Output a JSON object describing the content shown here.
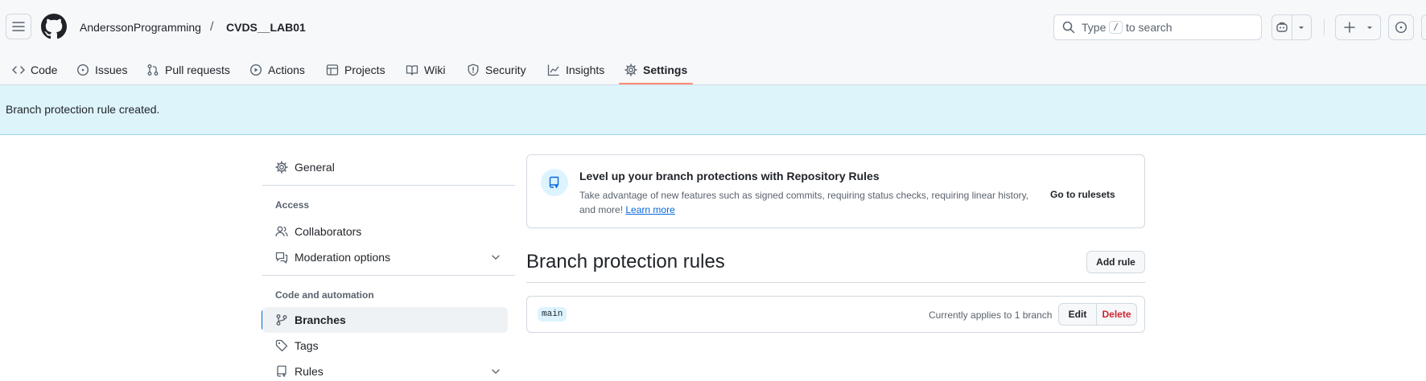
{
  "header": {
    "owner": "AnderssonProgramming",
    "separator": "/",
    "repo": "CVDS__LAB01",
    "search_prefix": "Type",
    "search_key": "/",
    "search_suffix": "to search"
  },
  "tabs": [
    {
      "label": "Code",
      "icon": "code-icon"
    },
    {
      "label": "Issues",
      "icon": "issue-opened-icon"
    },
    {
      "label": "Pull requests",
      "icon": "git-pull-request-icon"
    },
    {
      "label": "Actions",
      "icon": "play-icon"
    },
    {
      "label": "Projects",
      "icon": "table-icon"
    },
    {
      "label": "Wiki",
      "icon": "book-icon"
    },
    {
      "label": "Security",
      "icon": "shield-icon"
    },
    {
      "label": "Insights",
      "icon": "graph-icon"
    },
    {
      "label": "Settings",
      "icon": "gear-icon",
      "active": true
    }
  ],
  "flash": {
    "message": "Branch protection rule created."
  },
  "sidebar": {
    "general": "General",
    "access_heading": "Access",
    "collaborators": "Collaborators",
    "moderation": "Moderation options",
    "code_heading": "Code and automation",
    "branches": "Branches",
    "tags": "Tags",
    "rules": "Rules"
  },
  "banner": {
    "title": "Level up your branch protections with Repository Rules",
    "description": "Take advantage of new features such as signed commits, requiring status checks, requiring linear history, and more!",
    "learn_more": "Learn more",
    "cta": "Go to rulesets"
  },
  "rules": {
    "title": "Branch protection rules",
    "add_rule": "Add rule",
    "items": [
      {
        "branch": "main",
        "applies": "Currently applies to 1 branch",
        "edit": "Edit",
        "delete": "Delete"
      }
    ]
  },
  "colors": {
    "accent": "#0969da",
    "tab_underline": "#fd8c73",
    "flash_bg": "#ddf4fb",
    "danger": "#d1242f"
  }
}
